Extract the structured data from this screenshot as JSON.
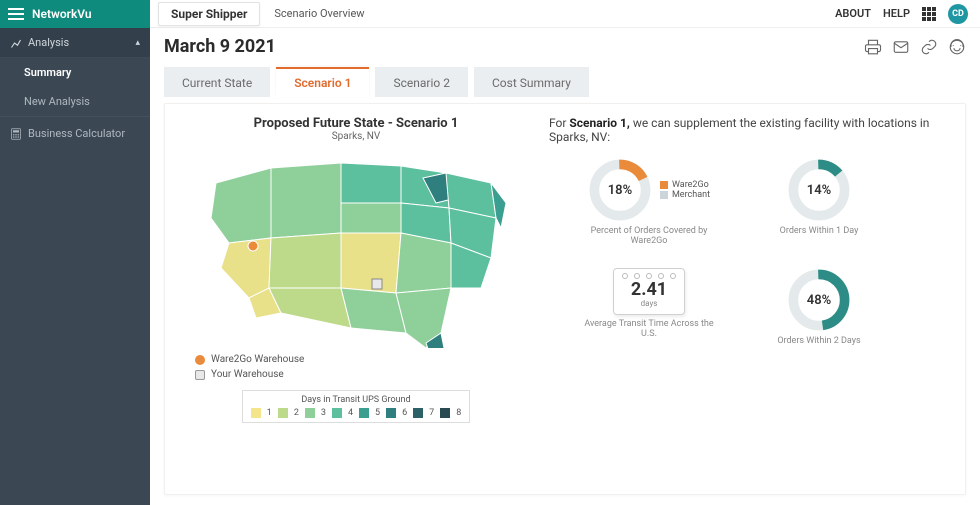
{
  "brand": "NetworkVu",
  "company": "Super Shipper",
  "page_title": "Scenario Overview",
  "nav_right": {
    "about": "ABOUT",
    "help": "HELP",
    "avatar_initials": "CD"
  },
  "sidebar": {
    "section": "Analysis",
    "items": [
      "Summary",
      "New Analysis"
    ],
    "calc": "Business Calculator"
  },
  "date_title": "March 9 2021",
  "tabs": [
    "Current State",
    "Scenario 1",
    "Scenario 2",
    "Cost Summary"
  ],
  "active_tab": 1,
  "map": {
    "title": "Proposed Future State - Scenario 1",
    "subtitle": "Sparks, NV",
    "legend_wh": [
      "Ware2Go Warehouse",
      "Your Warehouse"
    ],
    "transit_title": "Days in Transit UPS Ground",
    "transit_days": [
      "1",
      "2",
      "3",
      "4",
      "5",
      "6",
      "7",
      "8"
    ]
  },
  "description": {
    "prefix": "For ",
    "bold": "Scenario 1,",
    "rest": " we can supplement the existing facility with locations in Sparks, NV:"
  },
  "metrics": {
    "coverage": {
      "value": "18%",
      "percent": 18,
      "series": [
        {
          "name": "Ware2Go",
          "color": "#e98b3a"
        },
        {
          "name": "Merchant",
          "color": "#cbd4d8"
        }
      ],
      "label": "Percent of Orders Covered by Ware2Go"
    },
    "day1": {
      "value": "14%",
      "percent": 14,
      "color": "#2d8d86",
      "label": "Orders Within 1 Day"
    },
    "transit": {
      "value": "2.41",
      "unit": "days",
      "label": "Average Transit Time Across the U.S."
    },
    "day2": {
      "value": "48%",
      "percent": 48,
      "color": "#2d8d86",
      "label": "Orders Within 2 Days"
    }
  },
  "transit_colors": [
    "#f4e58a",
    "#bdd98a",
    "#8fcf9a",
    "#5cbf9d",
    "#3a9e90",
    "#2f7f7e",
    "#2c6267",
    "#294a52"
  ]
}
